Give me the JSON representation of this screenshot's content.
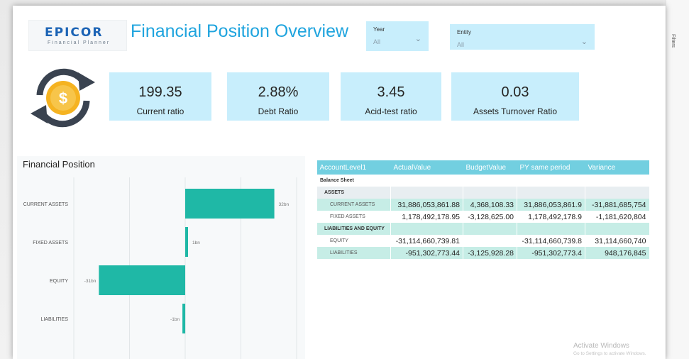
{
  "logo": {
    "main": "EPICOR",
    "sub": "Financial Planner"
  },
  "page_title": "Financial Position Overview",
  "slicers": [
    {
      "label": "Year",
      "value": "All"
    },
    {
      "label": "Entity",
      "value": "All"
    }
  ],
  "icon": "dollar-refresh-icon",
  "kpis": [
    {
      "value": "199.35",
      "label": "Current ratio"
    },
    {
      "value": "2.88%",
      "label": "Debt Ratio"
    },
    {
      "value": "3.45",
      "label": "Acid-test ratio"
    },
    {
      "value": "0.03",
      "label": "Assets Turnover Ratio"
    }
  ],
  "chart_data": {
    "type": "bar",
    "orientation": "horizontal",
    "title": "Financial Position",
    "categories": [
      "CURRENT ASSETS",
      "FIXED ASSETS",
      "EQUITY",
      "LIABILITIES"
    ],
    "values": [
      32,
      1,
      -31,
      -1
    ],
    "data_labels": [
      "32bn",
      "1bn",
      "-31bn",
      "-1bn"
    ],
    "unit": "bn",
    "xlim": [
      -40,
      40
    ],
    "x_ticks": [
      -40,
      -20,
      0,
      20,
      40
    ],
    "bar_color": "#1fb8a6",
    "grid": true
  },
  "table": {
    "columns": [
      "AccountLevel1",
      "ActualValue",
      "BudgetValue",
      "PY same period",
      "Variance"
    ],
    "rows": [
      {
        "kind": "section",
        "label": "Balance Sheet",
        "cells": [
          "",
          "",
          "",
          ""
        ]
      },
      {
        "kind": "group",
        "label": "ASSETS",
        "cells": [
          "",
          "",
          "",
          ""
        ]
      },
      {
        "kind": "item",
        "label": "CURRENT ASSETS",
        "cells": [
          "31,886,053,861.88",
          "4,368,108.33",
          "31,886,053,861.9",
          "-31,881,685,754"
        ]
      },
      {
        "kind": "item",
        "label": "FIXED ASSETS",
        "cells": [
          "1,178,492,178.95",
          "-3,128,625.00",
          "1,178,492,178.9",
          "-1,181,620,804"
        ]
      },
      {
        "kind": "group",
        "label": "LIABILITIES AND EQUITY",
        "cells": [
          "",
          "",
          "",
          ""
        ]
      },
      {
        "kind": "item",
        "label": "EQUITY",
        "cells": [
          "-31,114,660,739.81",
          "",
          "-31,114,660,739.8",
          "31,114,660,740"
        ]
      },
      {
        "kind": "item",
        "label": "LIABILITIES",
        "cells": [
          "-951,302,773.44",
          "-3,125,928.28",
          "-951,302,773.4",
          "948,176,845"
        ]
      }
    ]
  },
  "watermark": {
    "line1": "Activate Windows",
    "line2": "Go to Settings to activate Windows."
  },
  "side_pane_label": "Filters",
  "colors": {
    "accent": "#1fa4de",
    "tile": "#c8eefc",
    "header": "#72cfe0",
    "bar": "#1fb8a6"
  }
}
